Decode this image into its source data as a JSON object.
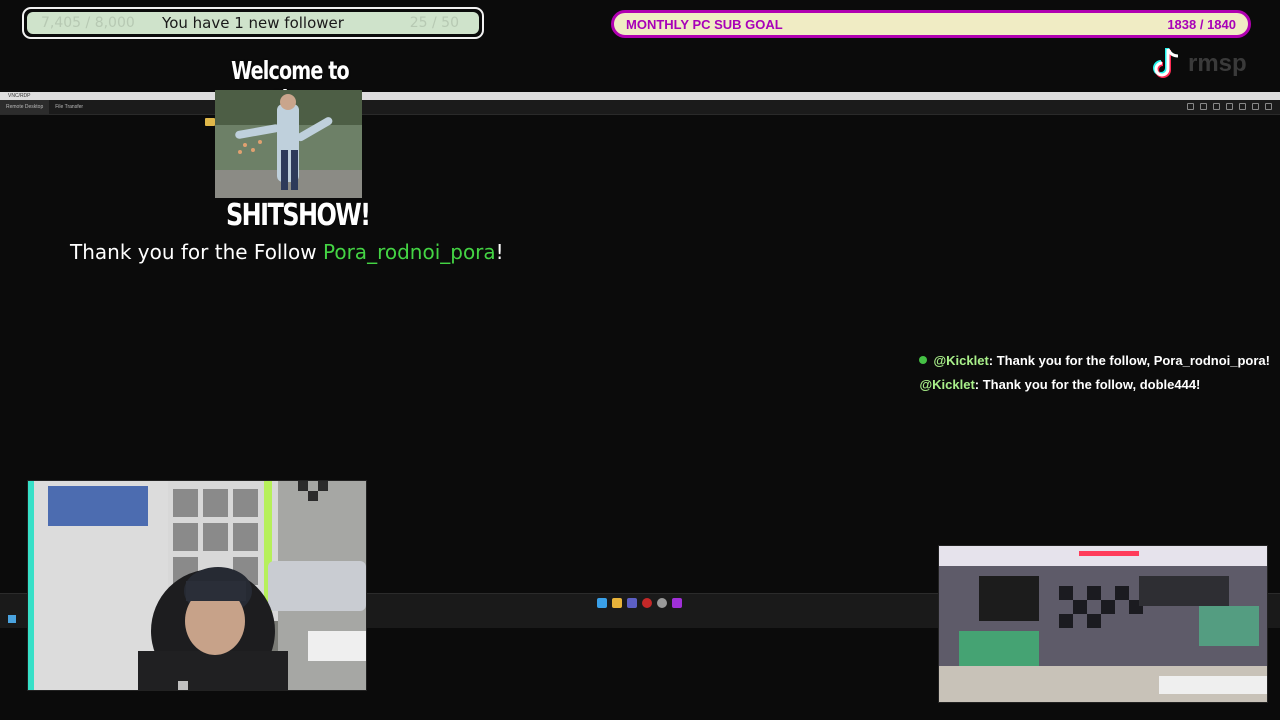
{
  "follower_alert": {
    "message": "You have 1 new follower",
    "ghost_left": "7,405 / 8,000",
    "ghost_right": "25 / 50"
  },
  "sub_goal": {
    "label": "MONTHLY PC SUB GOAL",
    "current": 1838,
    "target": 1840,
    "progress_text": "1838 / 1840"
  },
  "branding": {
    "watermark": "rmsp",
    "icon": "tiktok-icon"
  },
  "remote_desktop": {
    "title": "VNC/RDP",
    "tabs": [
      "Remote Desktop",
      "File Transfer"
    ]
  },
  "meme": {
    "top_text": "Welcome to the",
    "bottom_text": "SHITSHOW!"
  },
  "follow_alert": {
    "prefix": "Thank you for the Follow ",
    "name": "Pora_rodnoi_pora",
    "suffix": "!"
  },
  "chat": {
    "messages": [
      {
        "user": "@Kicklet",
        "text": " : Thank you for the follow, Pora_rodnoi_pora!",
        "verified": true
      },
      {
        "user": "@Kicklet",
        "text": " : Thank you for the follow, doble444!",
        "verified": false
      }
    ]
  },
  "colors": {
    "goal_border": "#b100b1",
    "goal_text": "#a800b8",
    "follow_name": "#44d444",
    "chat_user": "#a9f08a"
  }
}
